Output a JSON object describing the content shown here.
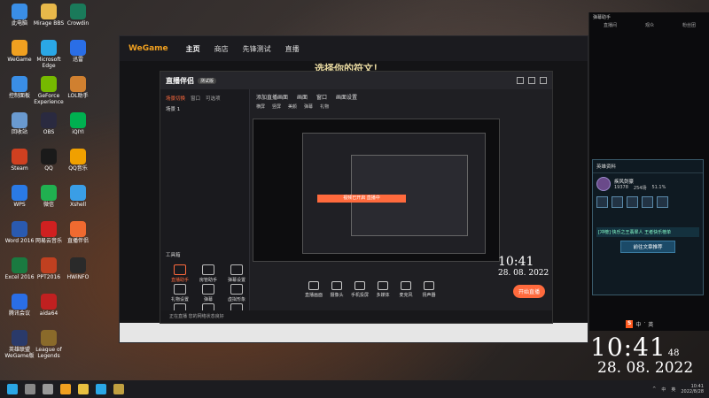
{
  "desktop": {
    "icons": [
      {
        "label": "此电脑",
        "color": "#3a8ee6",
        "col": 0,
        "row": 0
      },
      {
        "label": "Mirage BBS",
        "color": "#e8b84a",
        "col": 1,
        "row": 0
      },
      {
        "label": "Crowdin",
        "color": "#1a7a5a",
        "col": 2,
        "row": 0
      },
      {
        "label": "WeGame",
        "color": "#f0a020",
        "col": 0,
        "row": 1
      },
      {
        "label": "Microsoft Edge",
        "color": "#2aa7e6",
        "col": 1,
        "row": 1
      },
      {
        "label": "迅雷",
        "color": "#2a6ee6",
        "col": 2,
        "row": 1
      },
      {
        "label": "控制面板",
        "color": "#3a8ee6",
        "col": 0,
        "row": 2
      },
      {
        "label": "GeForce Experience",
        "color": "#76b900",
        "col": 1,
        "row": 2
      },
      {
        "label": "LOL助手",
        "color": "#d08030",
        "col": 2,
        "row": 2
      },
      {
        "label": "回收站",
        "color": "#6a9ad0",
        "col": 0,
        "row": 3
      },
      {
        "label": "OBS",
        "color": "#2a2a40",
        "col": 1,
        "row": 3
      },
      {
        "label": "iQIYI",
        "color": "#00b050",
        "col": 2,
        "row": 3
      },
      {
        "label": "Steam",
        "color": "#d04020",
        "col": 0,
        "row": 4
      },
      {
        "label": "QQ",
        "color": "#1a1a1a",
        "col": 1,
        "row": 4
      },
      {
        "label": "QQ音乐",
        "color": "#f0a000",
        "col": 2,
        "row": 4
      },
      {
        "label": "WPS",
        "color": "#2a7ae6",
        "col": 0,
        "row": 5
      },
      {
        "label": "微信",
        "color": "#20b050",
        "col": 1,
        "row": 5
      },
      {
        "label": "Xshell",
        "color": "#3a9ee6",
        "col": 2,
        "row": 5
      },
      {
        "label": "Word 2016",
        "color": "#2a5ab0",
        "col": 0,
        "row": 6
      },
      {
        "label": "网易云音乐",
        "color": "#d02020",
        "col": 1,
        "row": 6
      },
      {
        "label": "直播伴侣",
        "color": "#f06a30",
        "col": 2,
        "row": 6
      },
      {
        "label": "Excel 2016",
        "color": "#1a7a40",
        "col": 0,
        "row": 7
      },
      {
        "label": "PPT2016",
        "color": "#c04020",
        "col": 1,
        "row": 7
      },
      {
        "label": "HWiNFO",
        "color": "#2a2a2a",
        "col": 2,
        "row": 7
      },
      {
        "label": "腾讯会议",
        "color": "#2a6ee6",
        "col": 0,
        "row": 8
      },
      {
        "label": "aida64",
        "color": "#c02020",
        "col": 1,
        "row": 8
      },
      {
        "label": "英雄联盟 WeGame版",
        "color": "#2a3a6a",
        "col": 0,
        "row": 9
      },
      {
        "label": "League of Legends",
        "color": "#8a6a2a",
        "col": 1,
        "row": 9
      }
    ]
  },
  "wegame": {
    "logo": "WeGame",
    "tabs": [
      "主页",
      "商店",
      "先锋测试",
      "直播"
    ],
    "title": "选择你的符文！"
  },
  "zb": {
    "logo": "直播伴侣",
    "version": "测试版",
    "left_tabs": [
      "场景切换",
      "窗口",
      "可选项"
    ],
    "scene": "场景 1",
    "tools_title": "工具箱",
    "tools": [
      {
        "label": "直播助手",
        "on": true
      },
      {
        "label": "房管助手",
        "on": false
      },
      {
        "label": "弹幕设置",
        "on": false
      },
      {
        "label": "礼物设置",
        "on": false
      },
      {
        "label": "弹幕",
        "on": false
      },
      {
        "label": "虚拟形象",
        "on": false
      },
      {
        "label": "弹幕机",
        "on": false
      },
      {
        "label": "直播助手",
        "on": false
      },
      {
        "label": "直播PK",
        "on": false
      }
    ],
    "hdr": [
      "添加直播画面",
      "画面",
      "窗口",
      "画面设置"
    ],
    "hdr2": [
      "横屏",
      "竖屏",
      "美颜",
      "弹幕",
      "礼物"
    ],
    "preview_banner": "视频已开启 直播中",
    "bottom_btns": [
      "直播画面",
      "摄像头",
      "手机投屏",
      "多媒体",
      "麦克风",
      "扬声器"
    ],
    "start_live": "开始直播",
    "status": "正在直播 您的网络状态良好"
  },
  "stats": {
    "header": "弹幕助手",
    "cols": [
      "直播间",
      "观众",
      "粉丝团"
    ]
  },
  "hero_card": {
    "title": "英雄资料",
    "name": "疾风剑豪",
    "stats": [
      "19378",
      "254场",
      "51.1%"
    ],
    "badge": "[冲榜] 快乐之王翡翠人 王者快乐榜单",
    "button": "前往文章推荐"
  },
  "sogou": {
    "s": "S",
    "items": [
      "中",
      "·",
      "英"
    ]
  },
  "clock": {
    "time": "10:41",
    "sec": "48",
    "date": "28. 08. 2022"
  },
  "mid_clock": {
    "time": "10:41",
    "date": "28. 08. 2022"
  },
  "taskbar": {
    "icons": [
      {
        "name": "windows-start-icon",
        "color": "#2aa7e6"
      },
      {
        "name": "search-icon",
        "color": "#888"
      },
      {
        "name": "taskview-icon",
        "color": "#999"
      },
      {
        "name": "wegame-icon",
        "color": "#f0a020"
      },
      {
        "name": "explorer-icon",
        "color": "#e8c040"
      },
      {
        "name": "edge-icon",
        "color": "#2aa7e6"
      },
      {
        "name": "lol-icon",
        "color": "#c0a040"
      }
    ],
    "tray": [
      "^",
      "中",
      "英"
    ],
    "time": "10:41",
    "date": "2022/8/28"
  }
}
